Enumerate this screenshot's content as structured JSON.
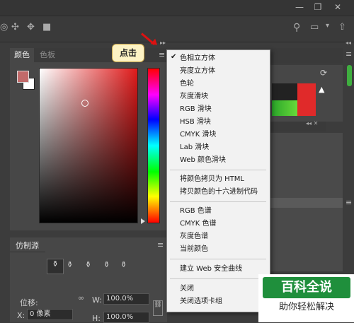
{
  "window": {
    "minimize_icon": "minimize-icon",
    "restore_icon": "restore-icon",
    "close_icon": "close-icon"
  },
  "color_panel": {
    "tabs": [
      {
        "label": "颜色"
      },
      {
        "label": "色板"
      }
    ],
    "foreground_color": "#c26a6a",
    "background_color": "#ffffff"
  },
  "tooltip": {
    "text": "点击"
  },
  "panel_menu": {
    "items": [
      {
        "label": "色相立方体",
        "checked": "✔"
      },
      {
        "label": "亮度立方体"
      },
      {
        "label": "色轮"
      },
      {
        "label": "灰度滑块"
      },
      {
        "label": "RGB 滑块"
      },
      {
        "label": "HSB 滑块"
      },
      {
        "label": "CMYK 滑块"
      },
      {
        "label": "Lab 滑块"
      },
      {
        "label": "Web 颜色滑块"
      },
      {
        "label": "将颜色拷贝为 HTML"
      },
      {
        "label": "拷贝颜色的十六进制代码"
      },
      {
        "label": "RGB 色谱"
      },
      {
        "label": "CMYK 色谱"
      },
      {
        "label": "灰度色谱"
      },
      {
        "label": "当前颜色"
      },
      {
        "label": "建立 Web 安全曲线"
      },
      {
        "label": "关闭"
      },
      {
        "label": "关闭选项卡组"
      }
    ]
  },
  "clone_panel": {
    "title": "仿制源",
    "offset_label": "位移:",
    "x_label": "X:",
    "x_value": "0 像素",
    "w_label": "W:",
    "w_value": "100.0%",
    "h_label": "H:",
    "h_value": "100.0%"
  },
  "histogram": {
    "warning": "▲"
  },
  "watermark": {
    "main": "百科全说",
    "sub": "助你轻松解决"
  }
}
